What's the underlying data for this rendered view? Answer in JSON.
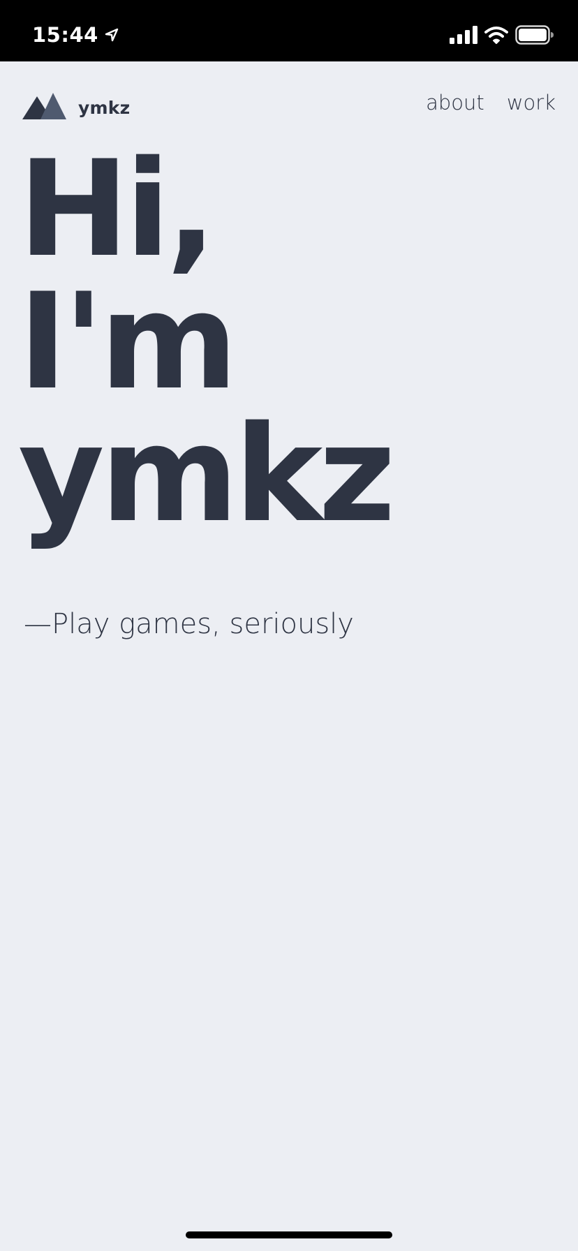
{
  "status_bar": {
    "time": "15:44",
    "icons": [
      "location-arrow-icon",
      "cellular-signal-icon",
      "wifi-icon",
      "battery-icon"
    ],
    "background": "#000000",
    "foreground": "#ffffff"
  },
  "header": {
    "logo_icon": "mountain-logo-icon",
    "logo_text": "ymkz",
    "nav": [
      {
        "label": "about"
      },
      {
        "label": "work"
      }
    ]
  },
  "hero": {
    "lines": [
      "Hi,",
      "I'm",
      "ymkz"
    ],
    "tagline": "—Play games, seriously"
  },
  "colors": {
    "background": "#eceef3",
    "text": "#2e3443",
    "logo_dark": "#2e3443",
    "logo_light": "#4f5a6f"
  }
}
